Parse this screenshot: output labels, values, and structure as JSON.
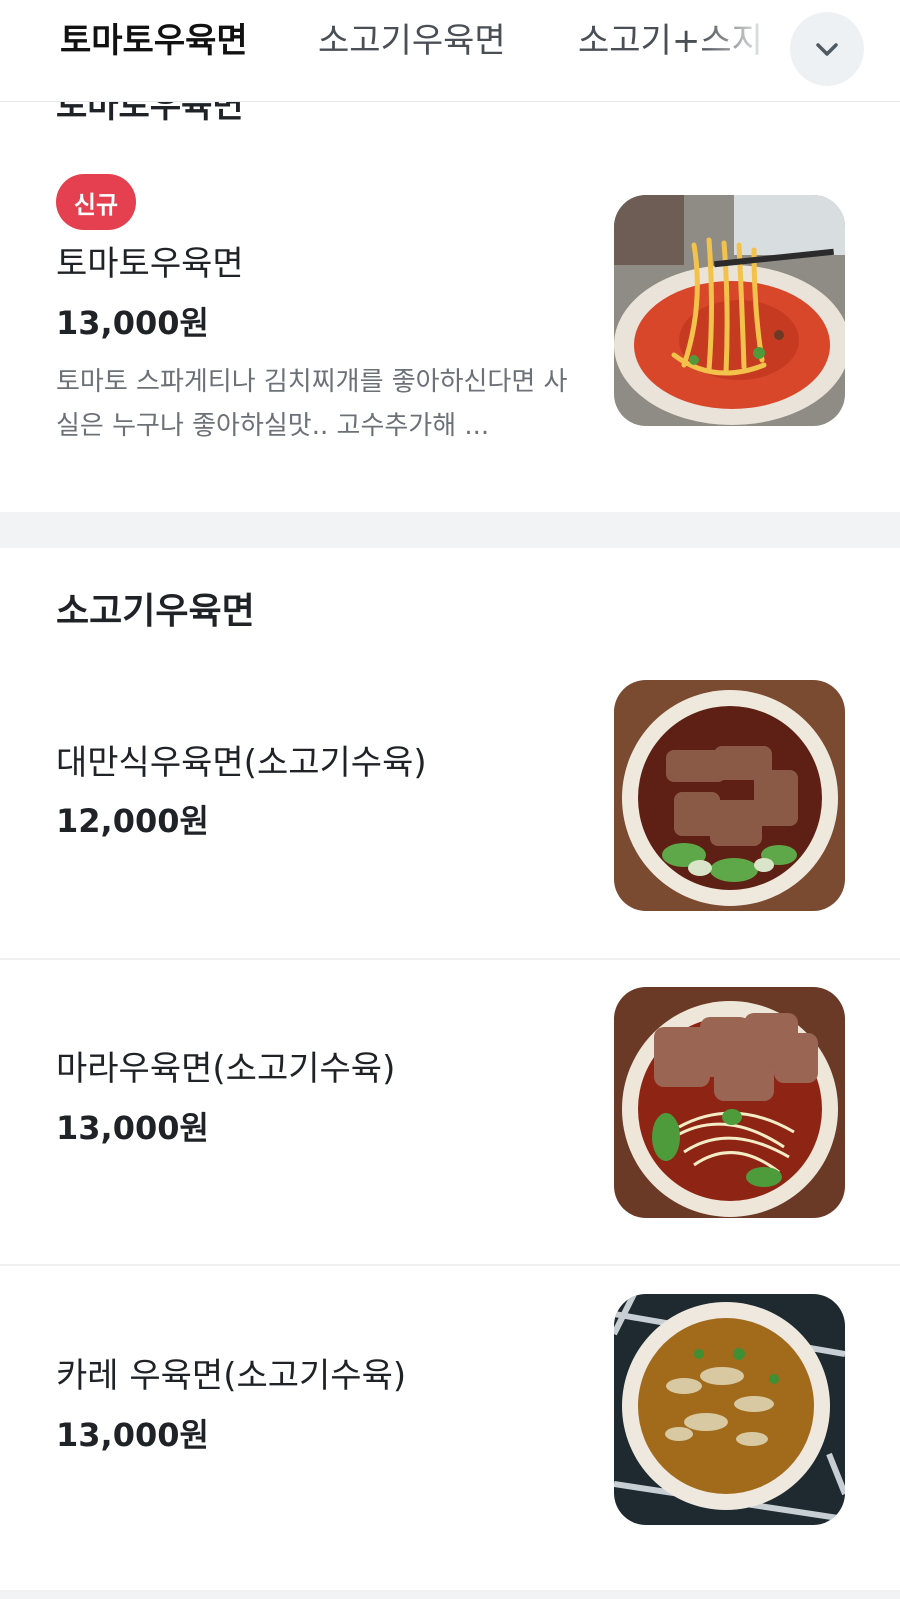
{
  "tabs": [
    {
      "label": "토마토우육면",
      "active": true
    },
    {
      "label": "소고기우육면",
      "active": false
    },
    {
      "label": "소고기+스지",
      "active": false
    }
  ],
  "tabbar": {
    "more_icon": "chevron-down-icon"
  },
  "cut_header": "토마토우육면",
  "sections": [
    {
      "title": "토마토우육면",
      "items": [
        {
          "badge": "신규",
          "name": "토마토우육면",
          "price": "13,000원",
          "description": "토마토 스파게티나 김치찌개를 좋아하신다면 사실은 누구나 좋아하실맛.. 고수추가해 ...",
          "photo": "tomato-noodle-photo"
        }
      ]
    },
    {
      "title": "소고기우육면",
      "items": [
        {
          "name": "대만식우육면(소고기수육)",
          "price": "12,000원",
          "photo": "taiwan-beef-noodle-photo"
        },
        {
          "name": "마라우육면(소고기수육)",
          "price": "13,000원",
          "photo": "mala-beef-noodle-photo"
        },
        {
          "name": "카레 우육면(소고기수육)",
          "price": "13,000원",
          "photo": "curry-beef-noodle-photo"
        }
      ]
    }
  ],
  "colors": {
    "badge": "#e5404f",
    "section_gap": "#f1f3f5",
    "text": "#1f2226",
    "desc": "#6b7177"
  }
}
